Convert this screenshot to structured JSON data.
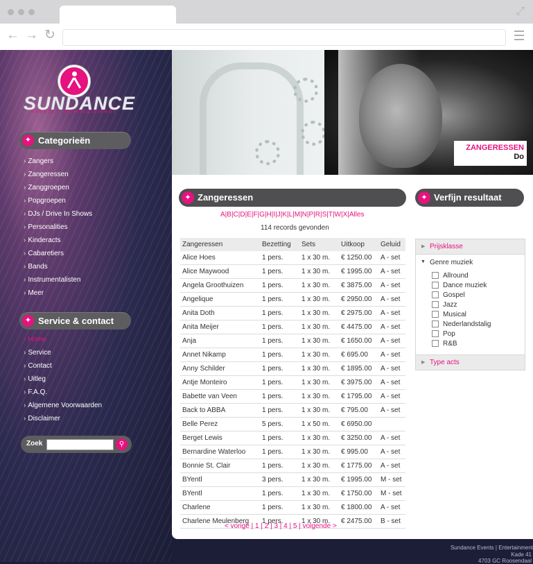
{
  "sidebar": {
    "logo": {
      "word": "SUNDANCE",
      "sub": "events | entertainment"
    },
    "categories_title": "Categorieën",
    "categories": [
      "Zangers",
      "Zangeressen",
      "Zanggroepen",
      "Popgroepen",
      "DJs / Drive In Shows",
      "Personalities",
      "Kinderacts",
      "Cabaretiers",
      "Bands",
      "Instrumentalisten",
      "Meer"
    ],
    "service_title": "Service & contact",
    "service": [
      "Home",
      "Service",
      "Contact",
      "Uitleg",
      "F.A.Q.",
      "Algemene Voorwaarden",
      "Disclaimer"
    ],
    "search_label": "Zoek"
  },
  "banner": {
    "caption1": "ZANGERESSEN",
    "caption2": "Do"
  },
  "main": {
    "title": "Zangeressen",
    "alpha": "A|B|C|D|E|F|G|H|I|J|K|L|M|N|P|R|S|T|W|X|Alles",
    "records": "114 records gevonden",
    "columns": [
      "Zangeressen",
      "Bezetting",
      "Sets",
      "Uitkoop",
      "Geluid"
    ],
    "rows": [
      [
        "Alice Hoes",
        "1 pers.",
        "1 x 30 m.",
        "€ 1250.00",
        "A - set"
      ],
      [
        "Alice Maywood",
        "1 pers.",
        "1 x 30 m.",
        "€ 1995.00",
        "A - set"
      ],
      [
        "Angela Groothuizen",
        "1 pers.",
        "1 x 30 m.",
        "€ 3875.00",
        "A - set"
      ],
      [
        "Angelique",
        "1 pers.",
        "1 x 30 m.",
        "€ 2950.00",
        "A - set"
      ],
      [
        "Anita Doth",
        "1 pers.",
        "1 x 30 m.",
        "€ 2975.00",
        "A - set"
      ],
      [
        "Anita Meijer",
        "1 pers.",
        "1 x 30 m.",
        "€ 4475.00",
        "A - set"
      ],
      [
        "Anja",
        "1 pers.",
        "1 x 30 m.",
        "€ 1650.00",
        "A - set"
      ],
      [
        "Annet Nikamp",
        "1 pers.",
        "1 x 30 m.",
        "€ 695.00",
        "A - set"
      ],
      [
        "Anny Schilder",
        "1 pers.",
        "1 x 30 m.",
        "€ 1895.00",
        "A - set"
      ],
      [
        "Antje Monteiro",
        "1 pers.",
        "1 x 30 m.",
        "€ 3975.00",
        "A - set"
      ],
      [
        "Babette van Veen",
        "1 pers.",
        "1 x 30 m.",
        "€ 1795.00",
        "A - set"
      ],
      [
        "Back to ABBA",
        "1 pers.",
        "1 x 30 m.",
        "€ 795.00",
        "A - set"
      ],
      [
        "Belle Perez",
        "5 pers.",
        "1 x 50 m.",
        "€ 6950.00",
        ""
      ],
      [
        "Berget Lewis",
        "1 pers.",
        "1 x 30 m.",
        "€ 3250.00",
        "A - set"
      ],
      [
        "Bernardine Waterloo",
        "1 pers.",
        "1 x 30 m.",
        "€ 995.00",
        "A - set"
      ],
      [
        "Bonnie St. Clair",
        "1 pers.",
        "1 x 30 m.",
        "€ 1775.00",
        "A - set"
      ],
      [
        "BYentl",
        "3 pers.",
        "1 x 30 m.",
        "€ 1995.00",
        "M - set"
      ],
      [
        "BYentl",
        "1 pers.",
        "1 x 30 m.",
        "€ 1750.00",
        "M - set"
      ],
      [
        "Charlene",
        "1 pers.",
        "1 x 30 m.",
        "€ 1800.00",
        "A - set"
      ],
      [
        "Charlene Meulenberg",
        "1 pers.",
        "1 x 30 m.",
        "€ 2475.00",
        "B - set"
      ]
    ],
    "pager": "< vorige | 1 | 2 | 3 | 4 | 5 | volgende >"
  },
  "filter": {
    "title": "Verfijn resultaat",
    "price": "Prijsklasse",
    "genre": "Genre muziek",
    "genres": [
      "Allround",
      "Dance muziek",
      "Gospel",
      "Jazz",
      "Musical",
      "Nederlandstalig",
      "Pop",
      "R&B"
    ],
    "type_acts": "Type acts"
  },
  "footer": {
    "line1": "Sundance Events | Entertainment",
    "line2": "Kade 41",
    "line3": "4703 GC Roosendaal"
  }
}
